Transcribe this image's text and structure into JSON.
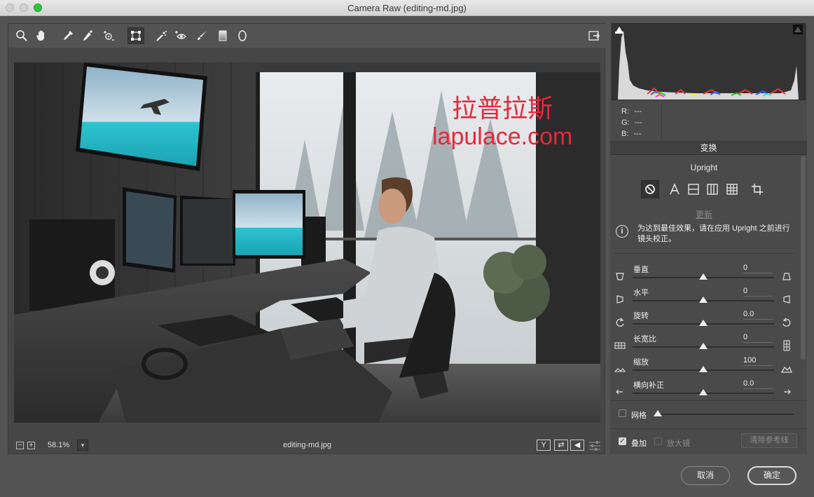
{
  "window": {
    "title": "Camera Raw (editing-md.jpg)"
  },
  "toolbar": {
    "tools": [
      {
        "name": "zoom-tool",
        "icon": "magnifier-icon"
      },
      {
        "name": "hand-tool",
        "icon": "hand-icon"
      },
      {
        "name": "white-balance-tool",
        "icon": "eyedropper-icon"
      },
      {
        "name": "color-sampler-tool",
        "icon": "color-sampler-icon"
      },
      {
        "name": "targeted-adjustment-tool",
        "icon": "targeted-adjustment-icon"
      },
      {
        "name": "transform-tool",
        "icon": "transform-icon",
        "selected": true
      },
      {
        "name": "spot-removal-tool",
        "icon": "spot-removal-icon"
      },
      {
        "name": "red-eye-tool",
        "icon": "red-eye-icon"
      },
      {
        "name": "adjustment-brush-tool",
        "icon": "brush-icon"
      },
      {
        "name": "graduated-filter-tool",
        "icon": "gradient-icon"
      },
      {
        "name": "radial-filter-tool",
        "icon": "radial-icon"
      }
    ],
    "fullscreen_icon": "fullscreen-icon"
  },
  "watermark": {
    "line1": "拉普拉斯",
    "line2": "lapulace.com"
  },
  "bottombar": {
    "zoom_minus": "−",
    "zoom_plus": "+",
    "zoom_value": "58.1%",
    "filename": "editing-md.jpg",
    "view_y": "Y",
    "swap_label": "⇄",
    "copy_label": "◀"
  },
  "histogram": {
    "r_label": "R:",
    "g_label": "G:",
    "b_label": "B:",
    "r_value": "---",
    "g_value": "---",
    "b_value": "---"
  },
  "panel": {
    "section_title": "变换",
    "upright_title": "Upright",
    "update_label": "更新",
    "info_text": "为达到最佳效果，请在应用 Upright 之前进行镜头校正。",
    "sliders": [
      {
        "label": "垂直",
        "value": "0",
        "pos": 0.5
      },
      {
        "label": "水平",
        "value": "0",
        "pos": 0.5
      },
      {
        "label": "旋转",
        "value": "0.0",
        "pos": 0.5
      },
      {
        "label": "长宽比",
        "value": "0",
        "pos": 0.5
      },
      {
        "label": "缩放",
        "value": "100",
        "pos": 0.5
      },
      {
        "label": "横向补正",
        "value": "0.0",
        "pos": 0.5
      }
    ],
    "grid_label": "网格",
    "overlay_label": "叠加",
    "loupe_label": "放大镜",
    "clear_guides_label": "清除参考线"
  },
  "dialog": {
    "cancel_label": "取消",
    "ok_label": "确定"
  },
  "colors": {
    "background": "#535353",
    "accent_green": "#2dc43f",
    "watermark": "#e8273b"
  }
}
